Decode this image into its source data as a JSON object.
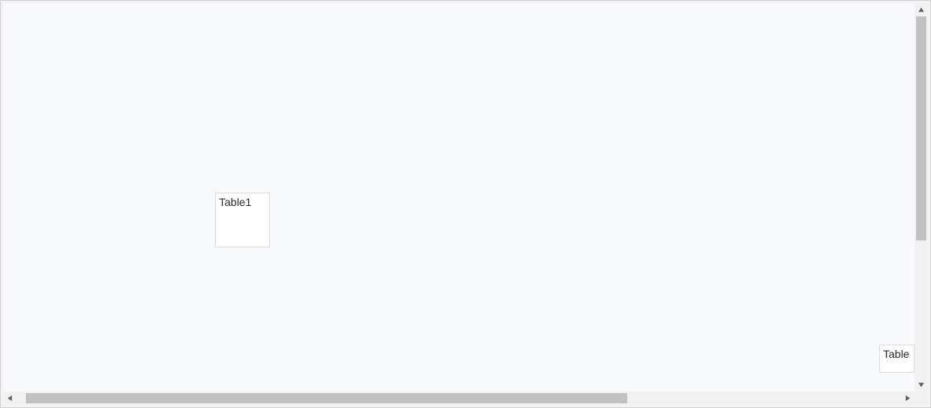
{
  "canvas": {
    "nodes": [
      {
        "id": "table1",
        "label": "Table1"
      },
      {
        "id": "table2",
        "label": "Table"
      }
    ]
  }
}
